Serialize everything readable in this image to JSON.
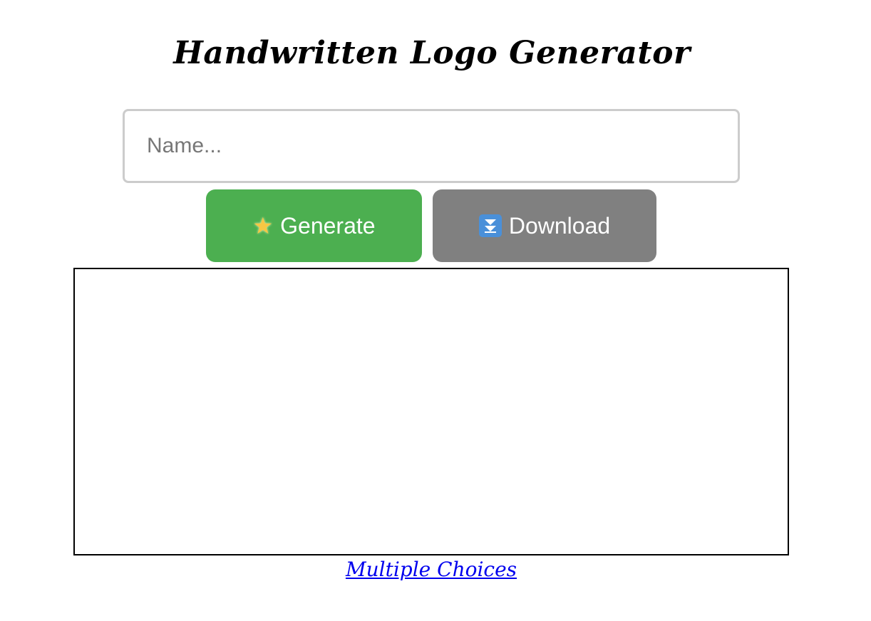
{
  "header": {
    "title": "Handwritten Logo Generator"
  },
  "form": {
    "name_placeholder": "Name...",
    "name_value": ""
  },
  "buttons": {
    "generate_label": "Generate",
    "generate_icon": "sparkle-star-icon",
    "generate_color": "#4caf50",
    "download_label": "Download",
    "download_icon": "double-down-arrow-icon",
    "download_color": "#808080"
  },
  "footer": {
    "link_label": "Multiple Choices",
    "link_color": "#0000ee"
  }
}
